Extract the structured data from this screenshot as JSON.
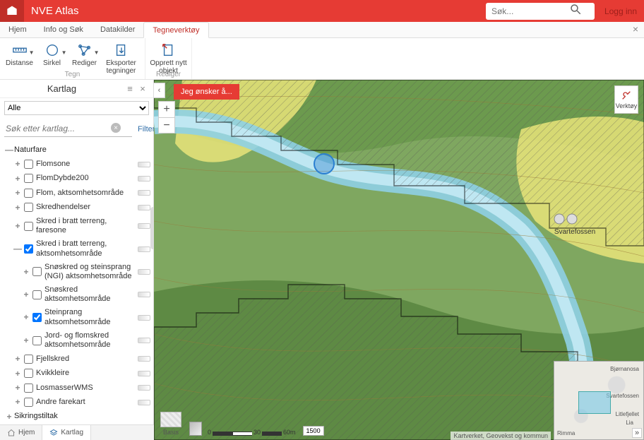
{
  "app": {
    "title": "NVE Atlas"
  },
  "search": {
    "placeholder": "Søk..."
  },
  "login": {
    "label": "Logg inn"
  },
  "tabs": {
    "items": [
      {
        "label": "Hjem"
      },
      {
        "label": "Info og Søk"
      },
      {
        "label": "Datakilder"
      },
      {
        "label": "Tegneverktøy"
      }
    ],
    "active_index": 3
  },
  "ribbon": {
    "groups": [
      {
        "label": "Tegn",
        "items": [
          {
            "name": "distance-tool",
            "label": "Distanse",
            "dropdown": true,
            "icon": "ruler"
          },
          {
            "name": "circle-tool",
            "label": "Sirkel",
            "dropdown": true,
            "icon": "circle"
          },
          {
            "name": "edit-tool",
            "label": "Rediger",
            "dropdown": true,
            "icon": "nodes"
          },
          {
            "name": "export-tool",
            "label": "Eksporter tegninger",
            "icon": "export",
            "wide": true
          }
        ]
      },
      {
        "label": "Rediger",
        "items": [
          {
            "name": "newobj-tool",
            "label": "Opprett nytt objekt",
            "icon": "newobj",
            "wide": true
          }
        ]
      }
    ]
  },
  "panel": {
    "title": "Kartlag",
    "dropdown_selected": "Alle",
    "search_placeholder": "Søk etter kartlag...",
    "filter_label": "Filter",
    "tree": {
      "group1": {
        "label": "Naturfare",
        "expanded": true
      },
      "items": [
        {
          "label": "Flomsone",
          "checked": false
        },
        {
          "label": "FlomDybde200",
          "checked": false
        },
        {
          "label": "Flom, aktsomhetsområde",
          "checked": false
        },
        {
          "label": "Skredhendelser",
          "checked": false
        },
        {
          "label": "Skred i bratt terreng, faresone",
          "checked": false
        },
        {
          "label": "Skred i bratt terreng, aktsomhetsområde",
          "checked": true,
          "expanded": true,
          "children": [
            {
              "label": "Snøskred og steinsprang (NGI) aktsomhetsområde",
              "checked": false
            },
            {
              "label": "Snøskred aktsomhetsområde",
              "checked": false
            },
            {
              "label": "Steinprang aktsomhetsområde",
              "checked": true
            },
            {
              "label": "Jord- og flomskred aktsomhetsområde",
              "checked": false
            }
          ]
        },
        {
          "label": "Fjellskred",
          "checked": false
        },
        {
          "label": "Kvikkleire",
          "checked": false
        },
        {
          "label": "LosmasserWMS",
          "checked": false
        },
        {
          "label": "Andre farekart",
          "checked": false
        }
      ],
      "group2": {
        "label": "Sikringstiltak",
        "expanded": false
      }
    }
  },
  "map": {
    "wish_label": "Jeg ønsker å...",
    "tools_label": "Verktøy",
    "basis_label": "Basis",
    "attribution": "Kartverket, Geovekst og kommun",
    "scale": {
      "t0": "0",
      "t1": "30",
      "t2": "60m",
      "ratio": "1500"
    },
    "place_label": "Svartefossen",
    "minimap_labels": {
      "a": "Bjørnanosa",
      "b": "Svartefossen",
      "c": "Litlefjellet",
      "d": "Lia",
      "e": "Rimma"
    }
  },
  "bottom_tabs": {
    "home": "Hjem",
    "layers": "Kartlag"
  }
}
